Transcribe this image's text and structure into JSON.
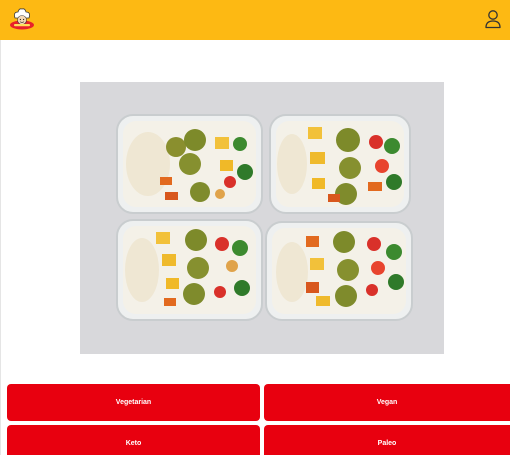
{
  "header": {
    "logo_icon": "chef-logo-icon",
    "user_icon": "user-account-icon"
  },
  "hero": {
    "image_subject": "meal-prep-containers-image"
  },
  "categories": [
    {
      "label": "Vegetarian"
    },
    {
      "label": "Vegan"
    },
    {
      "label": "Keto"
    },
    {
      "label": "Paleo"
    }
  ],
  "colors": {
    "header_bg": "#FDB913",
    "button_bg": "#E8000F",
    "button_text": "#FFFFFF"
  }
}
